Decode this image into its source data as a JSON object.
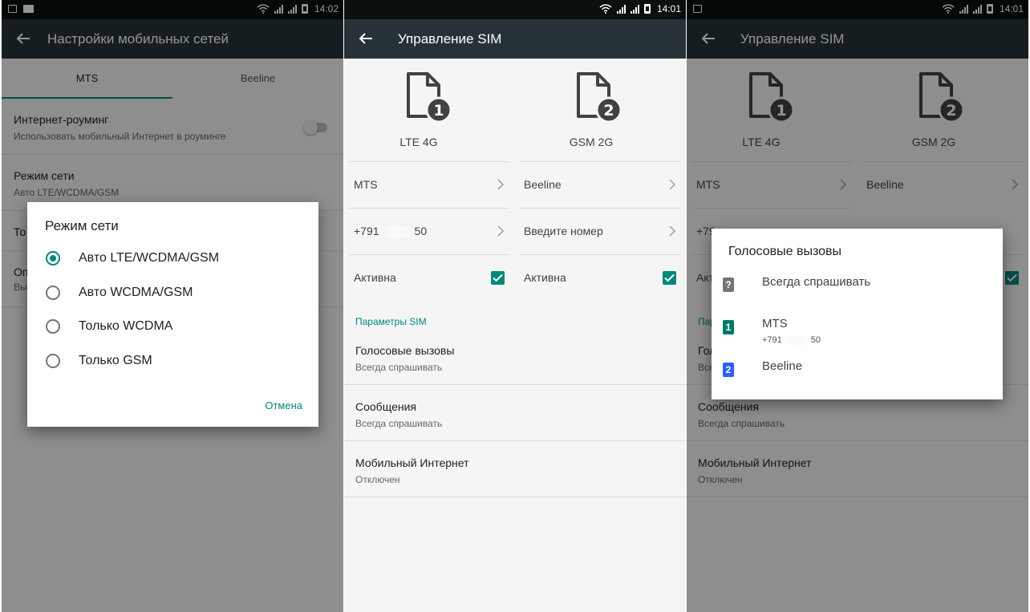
{
  "screen1": {
    "status": {
      "time": "14:02"
    },
    "toolbar": {
      "title": "Настройки мобильных сетей"
    },
    "tabs": [
      {
        "label": "MTS"
      },
      {
        "label": "Beeline"
      }
    ],
    "roaming": {
      "title": "Интернет-роуминг",
      "subtitle": "Использовать мобильный Интернет в роуминге",
      "enabled": false
    },
    "network_mode": {
      "title": "Режим сети",
      "subtitle": "Авто LTE/WCDMA/GSM"
    },
    "partial_rows": [
      {
        "title": "То"
      },
      {
        "title": "Оп",
        "subtitle": "Вы"
      }
    ],
    "dialog": {
      "title": "Режим сети",
      "options": [
        {
          "label": "Авто LTE/WCDMA/GSM",
          "selected": true
        },
        {
          "label": "Авто WCDMA/GSM",
          "selected": false
        },
        {
          "label": "Только WCDMA",
          "selected": false
        },
        {
          "label": "Только GSM",
          "selected": false
        }
      ],
      "cancel": "Отмена"
    }
  },
  "screen2": {
    "status": {
      "time": "14:01"
    },
    "toolbar": {
      "title": "Управление SIM"
    },
    "sims": [
      {
        "number_badge": "1",
        "network": "LTE 4G",
        "operator": "MTS",
        "phone_start": "+791",
        "phone_end": "50",
        "active_label": "Активна",
        "active": true
      },
      {
        "number_badge": "2",
        "network": "GSM 2G",
        "operator": "Beeline",
        "phone_placeholder": "Введите номер",
        "active_label": "Активна",
        "active": true
      }
    ],
    "section": "Параметры SIM",
    "prefs": [
      {
        "title": "Голосовые вызовы",
        "subtitle": "Всегда спрашивать"
      },
      {
        "title": "Сообщения",
        "subtitle": "Всегда спрашивать"
      },
      {
        "title": "Мобильный Интернет",
        "subtitle": "Отключен"
      }
    ]
  },
  "screen3": {
    "status": {
      "time": "14:01"
    },
    "toolbar": {
      "title": "Управление SIM"
    },
    "sims": [
      {
        "number_badge": "1",
        "network": "LTE 4G",
        "operator": "MTS",
        "phone_start": "+79"
      },
      {
        "number_badge": "2",
        "network": "GSM 2G",
        "operator": "Beeline"
      }
    ],
    "partial": {
      "active": "Акт",
      "section": "Пар",
      "voice_title": "Гол",
      "voice_sub": "Все"
    },
    "prefs": [
      {
        "title": "Сообщения",
        "subtitle": "Всегда спрашивать"
      },
      {
        "title": "Мобильный Интернет",
        "subtitle": "Отключен"
      }
    ],
    "dialog": {
      "title": "Голосовые вызовы",
      "options": [
        {
          "icon": "?",
          "label": "Всегда спрашивать",
          "color": "#757575"
        },
        {
          "icon": "1",
          "label": "MTS",
          "phone_start": "+791",
          "phone_end": "50",
          "color": "#00796b"
        },
        {
          "icon": "2",
          "label": "Beeline",
          "color": "#2962ff"
        }
      ]
    }
  }
}
